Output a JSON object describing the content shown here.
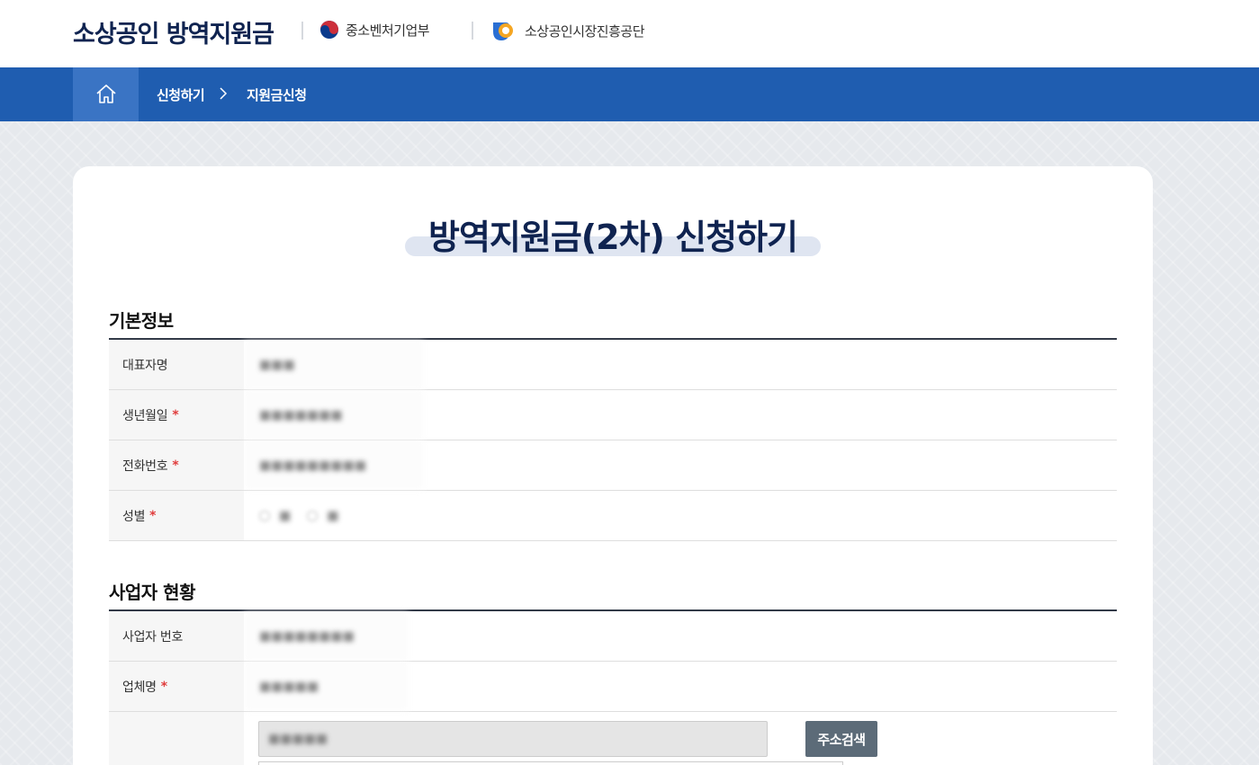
{
  "header": {
    "site_title": "소상공인 방역지원금",
    "ministry": "중소벤처기업부",
    "agency": "소상공인시장진흥공단"
  },
  "nav": {
    "home_icon": "home-icon",
    "crumb_1": "신청하기",
    "crumb_separator_icon": "chevron-right-icon",
    "crumb_2": "지원금신청"
  },
  "page": {
    "title": "방역지원금(2차) 신청하기"
  },
  "basic_info": {
    "section_title": "기본정보",
    "fields": [
      {
        "label": "대표자명",
        "required": false,
        "value": ""
      },
      {
        "label": "생년월일",
        "required": true,
        "value": ""
      },
      {
        "label": "전화번호",
        "required": true,
        "value": ""
      },
      {
        "label": "성별",
        "required": true,
        "value": ""
      }
    ]
  },
  "business_info": {
    "section_title": "사업자 현황",
    "fields": [
      {
        "label": "사업자 번호",
        "required": false,
        "value": ""
      },
      {
        "label": "업체명",
        "required": true,
        "value": ""
      },
      {
        "label": "",
        "required": false,
        "value": ""
      }
    ],
    "address_search_button": "주소검색"
  },
  "required_mark": "*",
  "colors": {
    "brand_navy": "#0f2350",
    "nav_blue": "#1f5db0",
    "required_red": "#e03c3c",
    "button_gray": "#5c6b78"
  }
}
